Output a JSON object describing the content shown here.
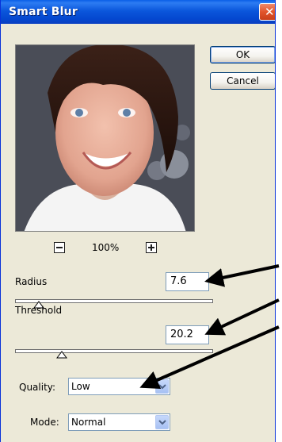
{
  "window": {
    "title": "Smart Blur",
    "close_glyph": "✕"
  },
  "buttons": {
    "ok": "OK",
    "cancel": "Cancel"
  },
  "zoom": {
    "level": "100%"
  },
  "radius": {
    "label": "Radius",
    "value": "7.6",
    "slider_fraction": 0.086
  },
  "threshold": {
    "label": "Threshold",
    "value": "20.2",
    "slider_fraction": 0.202
  },
  "quality": {
    "label": "Quality:",
    "selected": "Low"
  },
  "mode": {
    "label": "Mode:",
    "selected": "Normal"
  },
  "colors": {
    "title_bar": "#0b57dc",
    "dialog_bg": "#ece9d8",
    "close_button": "#e2542c",
    "field_border": "#7f9db9"
  },
  "icons": {
    "zoom_out": "minus-icon",
    "zoom_in": "plus-icon",
    "dropdown": "chevron-down-icon",
    "close": "close-icon"
  }
}
